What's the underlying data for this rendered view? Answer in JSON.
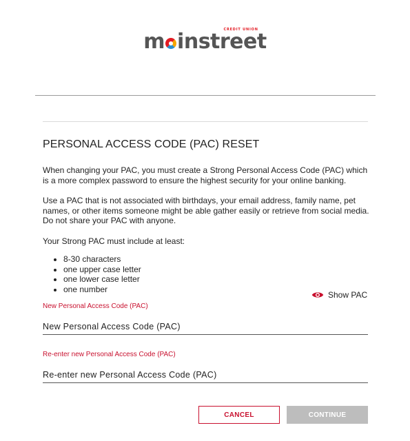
{
  "brand": {
    "logo_pre": "m",
    "logo_post": "instreet",
    "logo_tag": "CREDIT UNION",
    "colors": {
      "red": "#e31b23",
      "orange": "#f7a600",
      "blue": "#2a8fd0",
      "grey": "#555555"
    }
  },
  "page": {
    "title": "PERSONAL ACCESS CODE (PAC) RESET",
    "intro": "When changing your PAC, you must create a Strong Personal Access Code (PAC) which is a more complex password to ensure the highest security for your online banking.",
    "advice": "Use a PAC that is not associated with birthdays, your email address, family name, pet names, or other items someone might be able gather easily or retrieve from social media. Do not share your PAC with anyone.",
    "requirements_heading": "Your Strong PAC must include at least:",
    "requirements": [
      "8-30 characters",
      "one upper case letter",
      "one lower case letter",
      "one number"
    ]
  },
  "show_pac": {
    "label": "Show PAC",
    "icon": "eye-icon"
  },
  "form": {
    "new_pac": {
      "label": "New Personal Access Code (PAC)",
      "placeholder": "New Personal Access Code (PAC)",
      "value": ""
    },
    "confirm_pac": {
      "label": "Re-enter new Personal Access Code (PAC)",
      "placeholder": "Re-enter new Personal Access Code (PAC)",
      "value": ""
    }
  },
  "actions": {
    "cancel_label": "CANCEL",
    "continue_label": "CONTINUE"
  }
}
